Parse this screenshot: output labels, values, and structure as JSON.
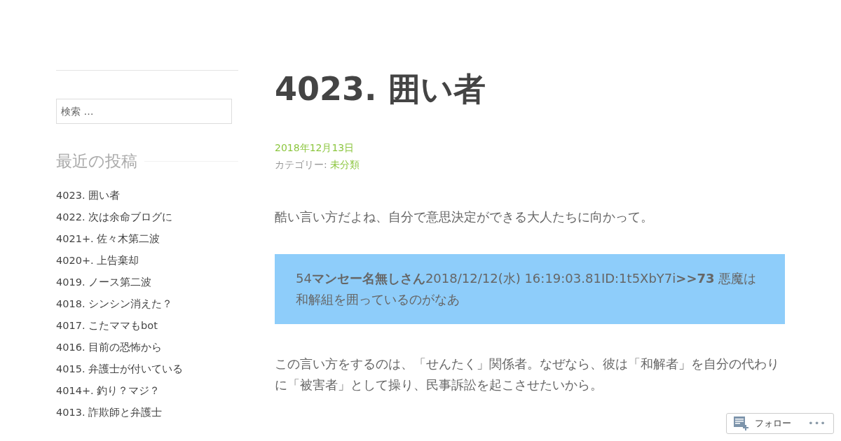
{
  "sidebar": {
    "search": {
      "placeholder": "検索 …"
    },
    "recent_posts": {
      "title": "最近の投稿",
      "items": [
        {
          "label": "4023. 囲い者"
        },
        {
          "label": "4022. 次は余命ブログに"
        },
        {
          "label": "4021+. 佐々木第二波"
        },
        {
          "label": "4020+. 上告棄却"
        },
        {
          "label": "4019. ノース第二波"
        },
        {
          "label": "4018. シンシン消えた？"
        },
        {
          "label": "4017. こたママもbot"
        },
        {
          "label": "4016. 目前の恐怖から"
        },
        {
          "label": "4015. 弁護士が付いている"
        },
        {
          "label": "4014+. 釣り？マジ？"
        },
        {
          "label": "4013. 詐欺師と弁護士"
        }
      ]
    }
  },
  "post": {
    "title": "4023. 囲い者",
    "date": "2018年12月13日",
    "category_label": "カテゴリー:",
    "category": "未分類",
    "body": [
      {
        "kind": "paragraph",
        "text": "酷い言い方だよね、自分で意思決定ができる大人たちに向かって。"
      },
      {
        "kind": "quote",
        "text": "54**マンセー名無しさん**2018/12/12(水) 16:19:03.81ID:1t5XbY7i**>>73** 悪魔は和解組を囲っているのがなあ"
      },
      {
        "kind": "paragraph",
        "text": "この言い方をするのは、「せんたく」関係者。なぜなら、彼は「和解者」を自分の代わりに「被害者」として操り、民事訴訟を起こさせたいから。"
      }
    ]
  },
  "follow_button": {
    "label": "フォロー",
    "more": "•••"
  }
}
